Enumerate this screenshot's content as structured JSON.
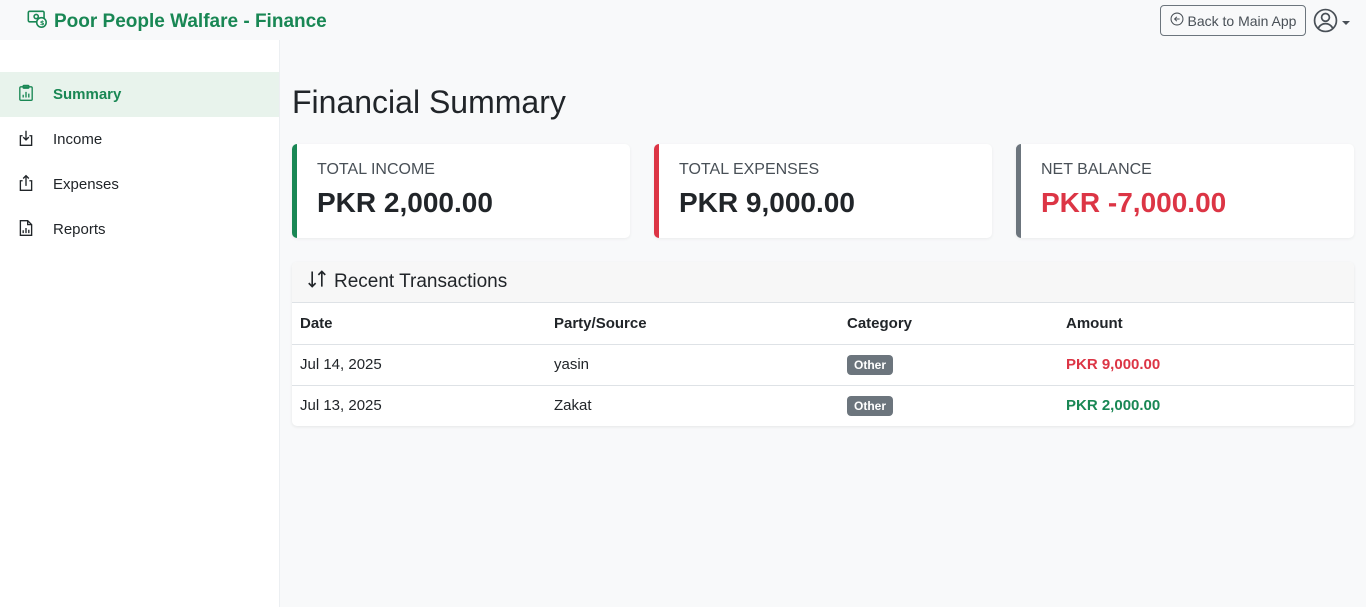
{
  "app": {
    "title": "Poor People Walfare - Finance",
    "back_label": "Back to Main App",
    "brand_icon": "cash-coin-icon",
    "accent": "#198754"
  },
  "sidebar": {
    "items": [
      {
        "label": "Summary",
        "icon": "clipboard-data-icon",
        "active": true
      },
      {
        "label": "Income",
        "icon": "box-arrow-in-down-icon",
        "active": false
      },
      {
        "label": "Expenses",
        "icon": "box-arrow-up-icon",
        "active": false
      },
      {
        "label": "Reports",
        "icon": "file-earmark-bar-graph-icon",
        "active": false
      }
    ]
  },
  "main": {
    "title": "Financial Summary",
    "cards": {
      "income": {
        "label": "TOTAL INCOME",
        "value": "PKR 2,000.00",
        "color": "#198754"
      },
      "expenses": {
        "label": "TOTAL EXPENSES",
        "value": "PKR 9,000.00",
        "color": "#dc3545"
      },
      "balance": {
        "label": "NET BALANCE",
        "value": "PKR -7,000.00",
        "color": "#6c757d"
      }
    },
    "transactions": {
      "title": "Recent Transactions",
      "columns": [
        "Date",
        "Party/Source",
        "Category",
        "Amount"
      ],
      "rows": [
        {
          "date": "Jul 14, 2025",
          "party": "yasin",
          "category": "Other",
          "amount": "PKR 9,000.00",
          "type": "expense"
        },
        {
          "date": "Jul 13, 2025",
          "party": "Zakat",
          "category": "Other",
          "amount": "PKR 2,000.00",
          "type": "income"
        }
      ]
    }
  }
}
